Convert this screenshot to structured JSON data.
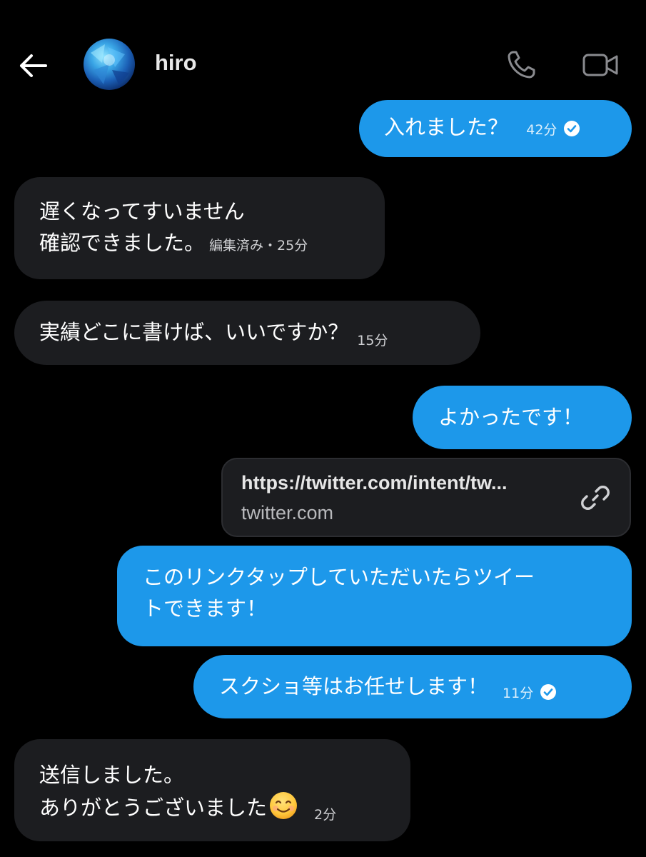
{
  "header": {
    "contact_name": "hiro"
  },
  "messages": {
    "m1": {
      "text": "入れました？",
      "time": "42分"
    },
    "m2": {
      "line1": "遅くなってすいません",
      "line2": "確認できました。",
      "meta": "編集済み・25分"
    },
    "m3": {
      "text": "実績どこに書けば、いいですか？",
      "time": "15分"
    },
    "m4": {
      "text": "よかったです！"
    },
    "link": {
      "title": "https://twitter.com/intent/tw...",
      "domain": "twitter.com"
    },
    "m5": {
      "line1": "このリンクタップしていただいたらツイー",
      "line2": "トできます！"
    },
    "m6": {
      "text": "スクショ等はお任せします！",
      "time": "11分"
    },
    "m7": {
      "line1": "送信しました。",
      "line2": "ありがとうございました",
      "time": "2分"
    }
  },
  "icons": {
    "back": "arrow-left-icon",
    "call": "phone-icon",
    "video": "video-camera-icon",
    "read": "check-circle-icon",
    "link": "link-icon",
    "emoji": "smiling-face-emoji"
  },
  "colors": {
    "outgoing_bubble": "#1d98ea",
    "incoming_bubble": "#1c1d20",
    "background": "#000000"
  }
}
